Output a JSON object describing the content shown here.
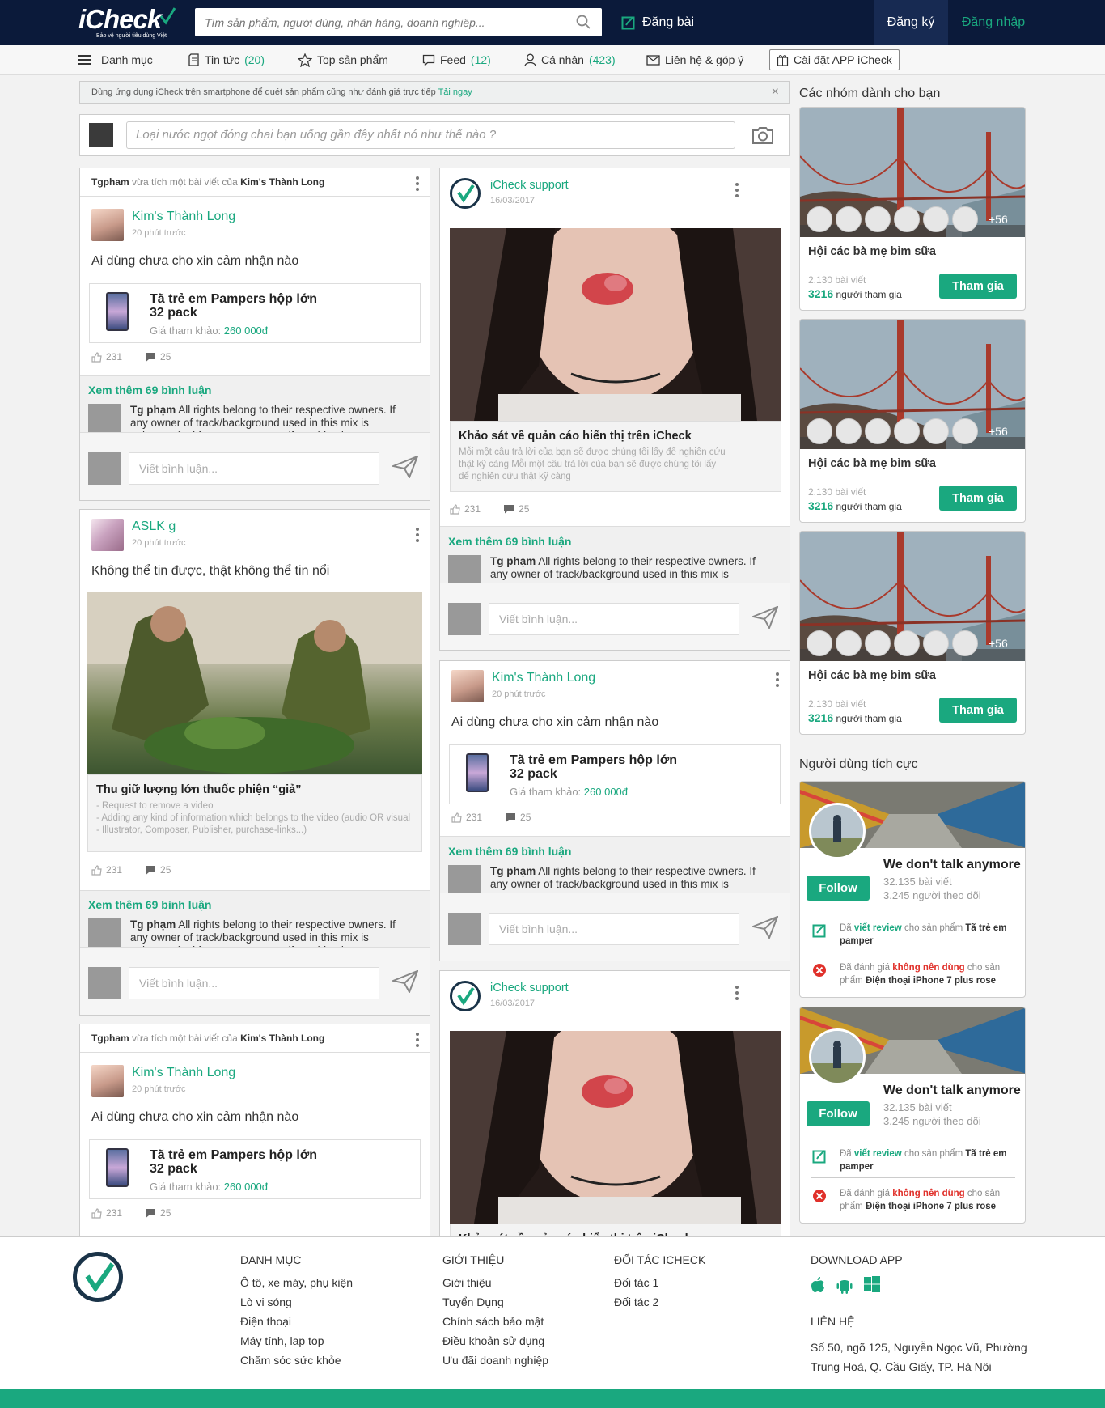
{
  "brand": {
    "logo": "iCheck",
    "tagline": "Bảo vệ người tiêu dùng Việt"
  },
  "header": {
    "search_placeholder": "Tìm sản phẩm, người dùng, nhãn hàng, doanh nghiệp...",
    "post_label": "Đăng bài",
    "signup": "Đăng ký",
    "login": "Đăng nhập"
  },
  "nav": {
    "menu": "Danh mục",
    "news": "Tin tức",
    "news_count": "(20)",
    "top": "Top sản phẩm",
    "feed": "Feed",
    "feed_count": "(12)",
    "personal": "Cá nhân",
    "personal_count": "(423)",
    "contact": "Liên hệ & góp ý",
    "install": "Cài đặt APP iCheck"
  },
  "notice": {
    "text": "Dùng ứng dụng iCheck trên smartphone để quét sản phẩm cũng như đánh giá trực tiếp",
    "link": "Tải ngay",
    "close": "×"
  },
  "composer": {
    "placeholder": "Loại nước ngọt đóng chai bạn uống gần đây nhất nó như thế nào ?"
  },
  "common": {
    "more_comments": "Xem thêm 69 bình luận",
    "write_placeholder": "Viết bình luận...",
    "likes": "231",
    "comments": "25",
    "comment_user": "Tg phạm",
    "comment_text": "All rights belong to their respective owners. If any owner of track/background used in this mix is unhappy, feel free to contact me if anything is wrong: tgpham",
    "share_user": "Tgpham",
    "share_mid": "vừa tích một bài viết của",
    "share_target": "Kim's Thành Long"
  },
  "posts": {
    "p1": {
      "author": "Kim's Thành Long",
      "time": "20 phút trước",
      "text": "Ai dùng chưa cho xin cảm nhận nào",
      "product_name": "Tã trẻ em Pampers hộp lớn 32 pack",
      "price_label": "Giá tham khảo:",
      "price": "260 000đ"
    },
    "p2": {
      "author": "ASLK g",
      "time": "20 phút trước",
      "text": "Không thể tin được, thật không thể tin nổi",
      "cap_title": "Thu giữ lượng lớn thuốc phiện “giả”",
      "cap_desc": "- Request to remove a video\n- Adding any kind of information which belongs to the video (audio OR visual - Illustrator, Composer, Publisher, purchase-links...)"
    },
    "s1": {
      "author": "iCheck support",
      "time": "16/03/2017",
      "cap_title": "Khảo sát về quản cáo hiển thị trên iCheck",
      "cap_desc": "Mỗi một câu trả lời của bạn sẽ được chúng tôi lấy để nghiên cứu thật kỹ càng Mỗi một câu trả lời của bạn sẽ được chúng tôi lấy để nghiên cứu thật kỹ càng"
    }
  },
  "sidebar": {
    "groups_title": "Các nhóm dành cho bạn",
    "group": {
      "name": "Hội các bà mẹ bỉm sữa",
      "posts": "2.130 bài viết",
      "members": "3216",
      "members_label": "người tham gia",
      "join": "Tham gia",
      "more": "+56"
    },
    "users_title": "Người dùng tích cực",
    "user": {
      "name": "We don't talk anymore",
      "posts": "32.135 bài viết",
      "followers": "3.245 người theo dõi",
      "follow": "Follow",
      "a1_pre": "Đã",
      "a1_em": "viết review",
      "a1_mid": "cho sản phẩm",
      "a1_obj": "Tã trẻ em pamper",
      "a2_pre": "Đã đánh giá",
      "a2_em": "không nên dùng",
      "a2_mid": "cho sản phẩm",
      "a2_obj": "Điện thoại iPhone 7 plus rose"
    }
  },
  "footer": {
    "cat_title": "DANH MỤC",
    "cats": [
      "Ô tô, xe máy, phụ kiện",
      "Lò vi sóng",
      "Điện thoại",
      "Máy tính, lap top",
      "Chăm sóc sức khỏe"
    ],
    "about_title": "GIỚI THIỆU",
    "about": [
      "Giới thiệu",
      "Tuyển Dụng",
      "Chính sách bảo mật",
      "Điều khoản sử dụng",
      "Ưu đãi doanh nghiệp"
    ],
    "partner_title": "ĐỐI TÁC ICHECK",
    "partners": [
      "Đối tác 1",
      "Đối tác 2"
    ],
    "app_title": "DOWNLOAD APP",
    "contact_title": "LIÊN HỆ",
    "address": "Số 50, ngõ 125, Nguyễn Ngọc Vũ, Phường Trung Hoà, Q. Cầu Giấy, TP. Hà Nội"
  },
  "colors": {
    "navy": "#0b1a3a",
    "accent": "#1aa87f",
    "danger": "#e0302a"
  }
}
